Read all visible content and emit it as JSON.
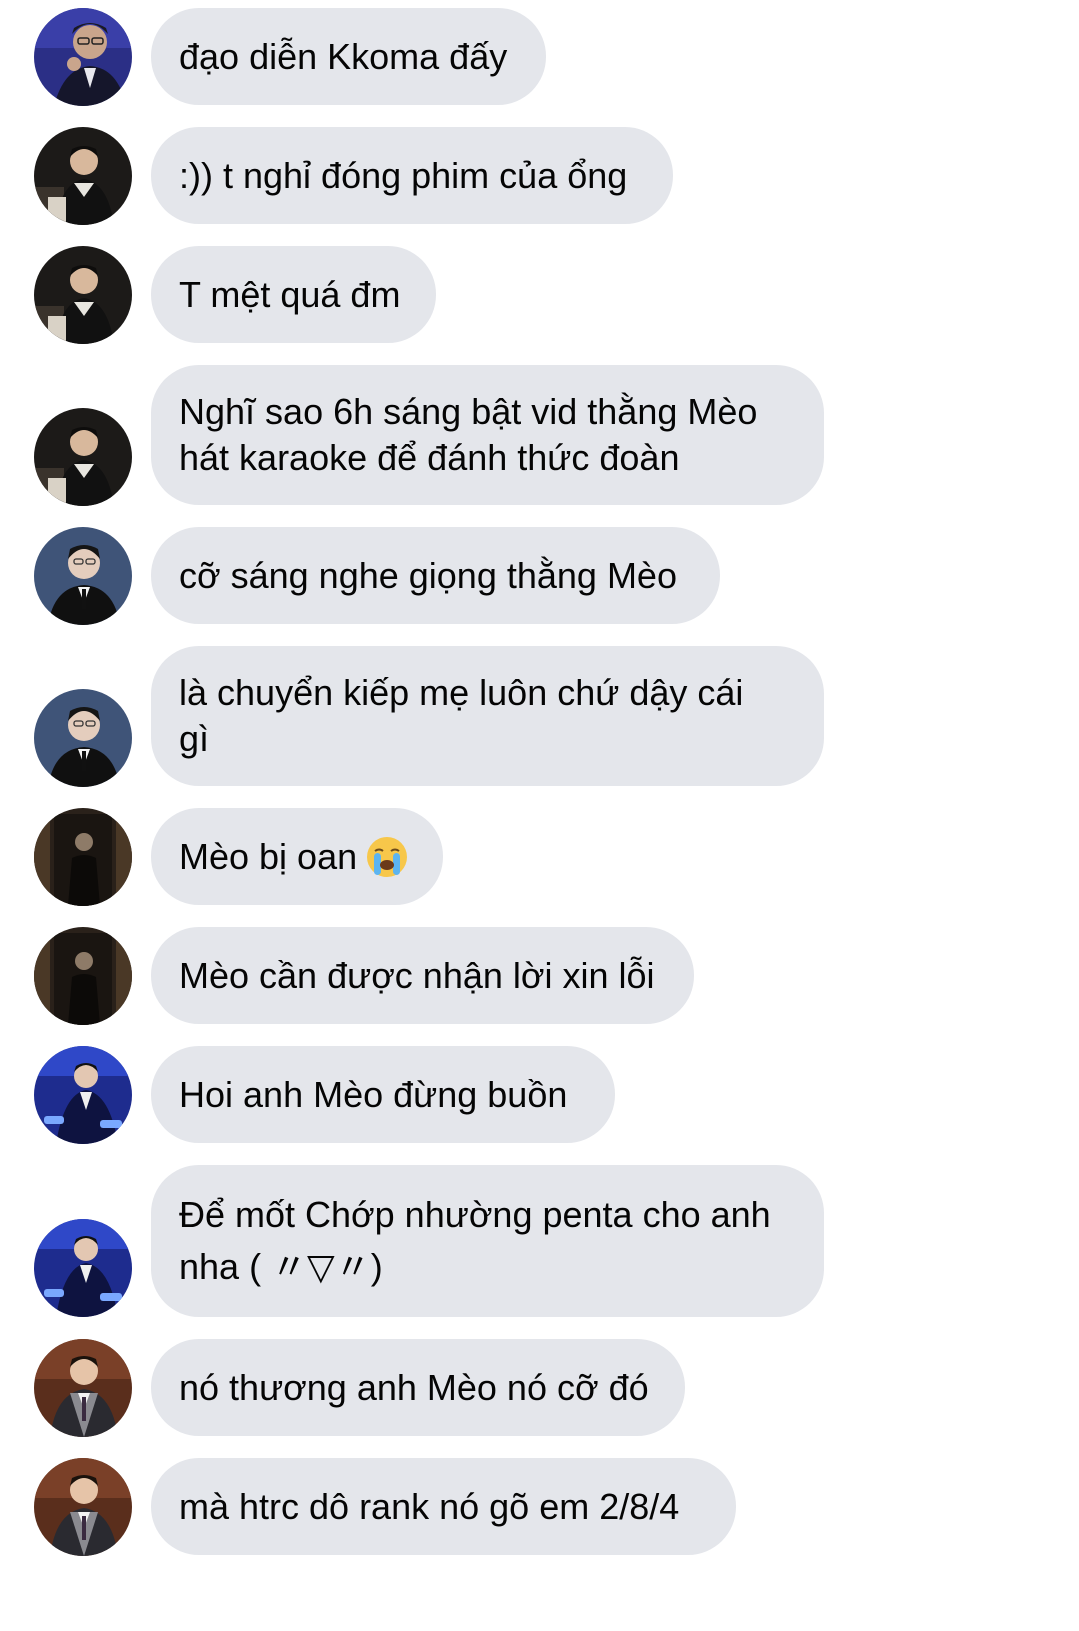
{
  "messages": [
    {
      "text": "đạo diễn Kkoma đấy",
      "avatar": "avatar-glasses-guy"
    },
    {
      "text": ":)) t nghỉ đóng phim của ổng",
      "avatar": "avatar-dark-sweater"
    },
    {
      "text": "T mệt quá đm",
      "avatar": "avatar-dark-sweater"
    },
    {
      "text": "Nghĩ sao 6h sáng bật vid thằng Mèo\nhát karaoke để đánh thức đoàn",
      "avatar": "avatar-dark-sweater"
    },
    {
      "text": "cỡ sáng nghe giọng thằng Mèo",
      "avatar": "avatar-suit-guy"
    },
    {
      "text": "là chuyển kiếp mẹ luôn chứ dậy cái\ngì",
      "avatar": "avatar-suit-guy"
    },
    {
      "text": "Mèo bị oan",
      "avatar": "avatar-dark-room",
      "emoji": "crying-face-emoji"
    },
    {
      "text": "Mèo cần được nhận lời xin lỗi",
      "avatar": "avatar-dark-room"
    },
    {
      "text": "Hoi anh Mèo đừng buồn",
      "avatar": "avatar-stage-blue"
    },
    {
      "text": "Để mốt Chớp nhường penta cho anh\nnha ( 〃▽〃)",
      "avatar": "avatar-stage-blue"
    },
    {
      "text": "nó thương anh Mèo nó cỡ đó",
      "avatar": "avatar-vest-guy"
    },
    {
      "text": "mà htrc dô rank nó gõ em 2/8/4",
      "avatar": "avatar-vest-guy"
    }
  ],
  "colors": {
    "bubble": "#e4e6eb",
    "text": "#050505",
    "background": "#ffffff"
  }
}
